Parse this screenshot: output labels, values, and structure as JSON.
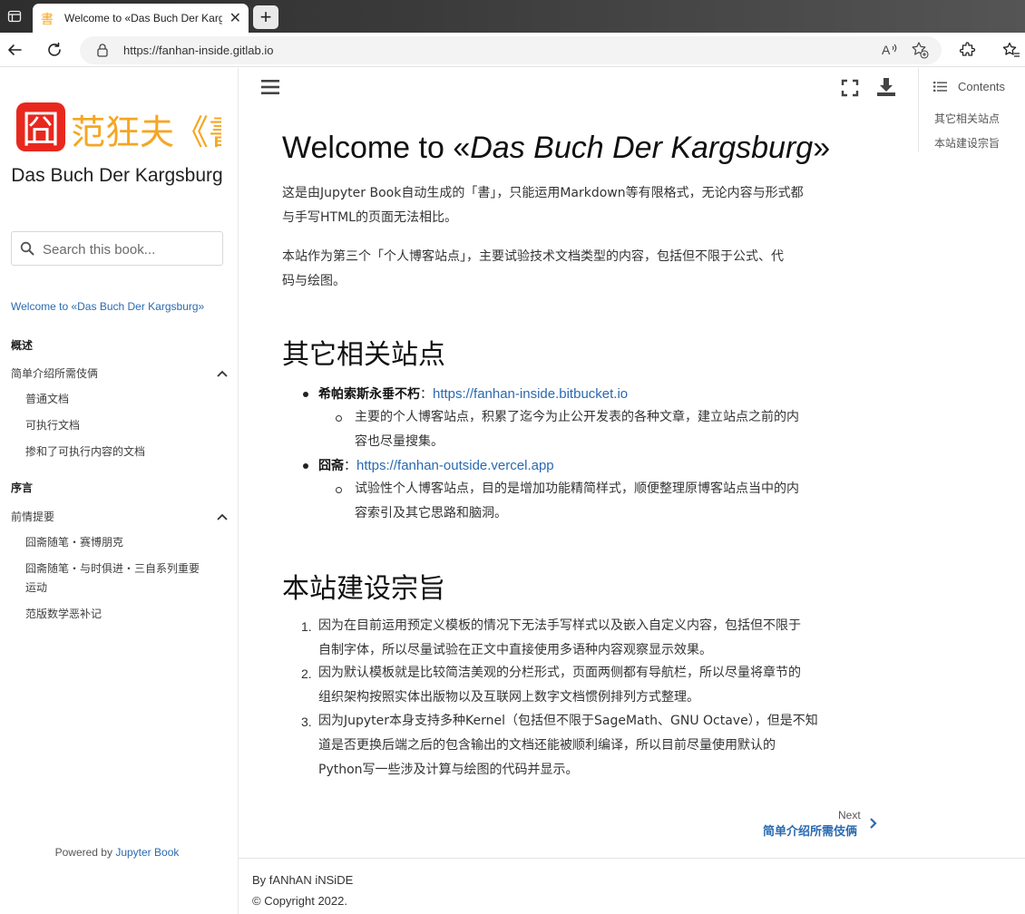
{
  "browser": {
    "tab_title": "Welcome to «Das Buch Der Kargsburg»",
    "tab_close": "✕",
    "new_tab": "+",
    "favicon_text": "書",
    "url": "https://fanhan-inside.gitlab.io"
  },
  "sidebar": {
    "logo_text": "范狂夫《書》",
    "logo_seal": "囧",
    "book_title": "Das Buch Der Kargsburg",
    "search_placeholder": "Search this book...",
    "nav": {
      "home": "Welcome to «Das Buch Der Kargsburg»",
      "caption1": "概述",
      "section1": "简单介绍所需伎俩",
      "section1_items": [
        "普通文档",
        "可执行文档",
        "掺和了可执行内容的文档"
      ],
      "caption2": "序言",
      "section2": "前情提要",
      "section2_items": [
        "囧斋随笔・赛博朋克",
        "囧斋随笔・与时俱进・三自系列重要",
        "运动",
        "范版数学恶补记"
      ]
    },
    "powered_prefix": "Powered by",
    "powered_link": "Jupyter Book"
  },
  "toc": {
    "header": "Contents",
    "items": [
      "其它相关站点",
      "本站建设宗旨"
    ]
  },
  "content": {
    "title_prefix": "Welcome to «",
    "title_em": "Das Buch Der Kargsburg",
    "title_suffix": "»",
    "para1_line1": "这是由Jupyter Book自动生成的「書」，只能运用Markdown等有限格式，无论内容与形式都",
    "para1_line2": "与手写HTML的页面无法相比。",
    "para2_line1": "本站作为第三个「个人博客站点」，主要试验技术文档类型的内容，包括但不限于公式、代",
    "para2_line2": "码与绘图。",
    "h2_related": "其它相关站点",
    "related": [
      {
        "name": "希帕索斯永垂不朽",
        "sep": "：",
        "link": "https://fanhan-inside.bitbucket.io",
        "desc_line1": "主要的个人博客站点，积累了迄今为止公开发表的各种文章，建立站点之前的内",
        "desc_line2": "容也尽量搜集。"
      },
      {
        "name": "囧斋",
        "sep": "：",
        "link": "https://fanhan-outside.vercel.app",
        "desc_line1": "试验性个人博客站点，目的是增加功能精简样式，顺便整理原博客站点当中的内",
        "desc_line2": "容索引及其它思路和脑洞。"
      }
    ],
    "h2_purpose": "本站建设宗旨",
    "purpose": [
      {
        "num": "1.",
        "line1": "因为在目前运用预定义模板的情况下无法手写样式以及嵌入自定义内容，包括但不限于",
        "line2": "自制字体，所以尽量试验在正文中直接使用多语种内容观察显示效果。",
        "line3": ""
      },
      {
        "num": "2.",
        "line1": "因为默认模板就是比较简洁美观的分栏形式，页面两侧都有导航栏，所以尽量将章节的",
        "line2": "组织架构按照实体出版物以及互联网上数字文档惯例排列方式整理。",
        "line3": ""
      },
      {
        "num": "3.",
        "line1": "因为Jupyter本身支持多种Kernel（包括但不限于SageMath、GNU Octave），但是不知",
        "line2": "道是否更换后端之后的包含输出的文档还能被顺利编译，所以目前尽量使用默认的",
        "line3": "Python写一些涉及计算与绘图的代码并显示。"
      }
    ],
    "next_label": "Next",
    "next_link": "简单介绍所需伎俩"
  },
  "footer": {
    "by": "By fANhAN iNSiDE",
    "copyright": "© Copyright 2022."
  },
  "colors": {
    "link": "#2a6ab0",
    "seal_red": "#e8281e",
    "logo_orange": "#f5a623"
  }
}
